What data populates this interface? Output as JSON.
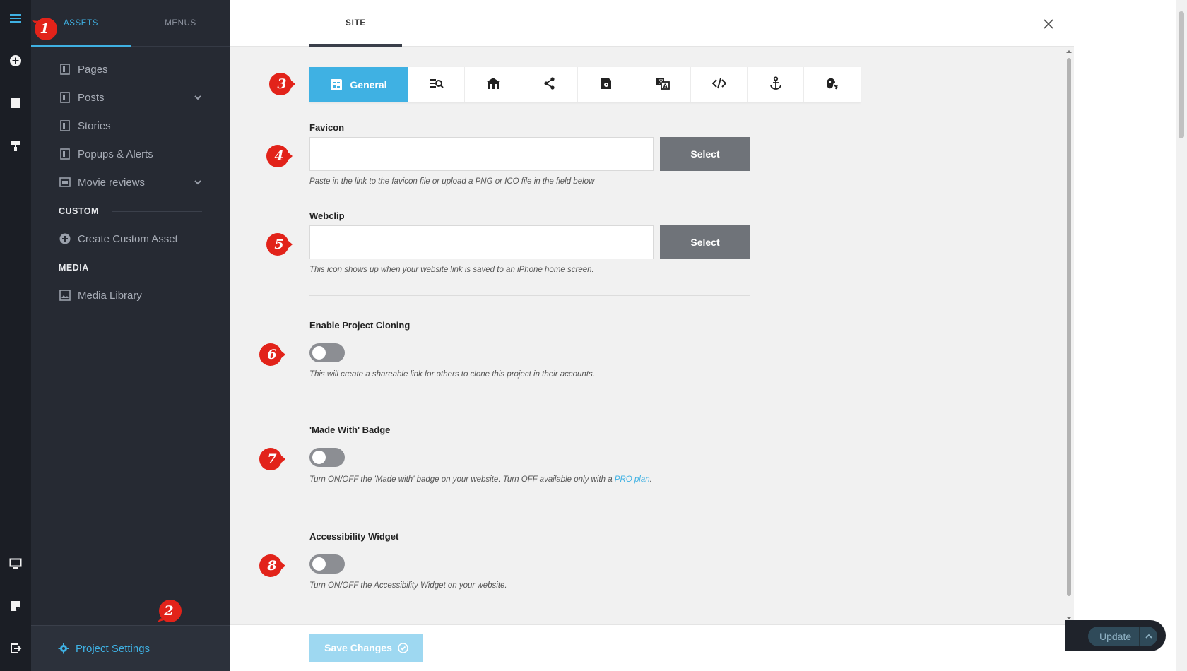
{
  "colors": {
    "accent": "#3fb1e3",
    "marker": "#e2231a",
    "rail_bg": "#1b1e25",
    "panel_bg": "#262a33"
  },
  "rail": {
    "icons": [
      "menu-icon",
      "add-icon",
      "layers-icon",
      "paint-roller-icon",
      "monitor-icon",
      "note-icon",
      "exit-icon"
    ]
  },
  "assets_panel": {
    "tabs": [
      {
        "label": "ASSETS",
        "active": true
      },
      {
        "label": "MENUS",
        "active": false
      }
    ],
    "items": [
      {
        "label": "Pages",
        "icon": "page-icon"
      },
      {
        "label": "Posts",
        "icon": "page-icon",
        "expandable": true
      },
      {
        "label": "Stories",
        "icon": "page-icon"
      },
      {
        "label": "Popups & Alerts",
        "icon": "page-icon"
      },
      {
        "label": "Movie reviews",
        "icon": "ticket-icon",
        "expandable": true
      }
    ],
    "custom_label": "CUSTOM",
    "create_custom": "Create Custom Asset",
    "media_label": "MEDIA",
    "media_library": "Media Library",
    "project_settings": "Project Settings"
  },
  "modal": {
    "tab": "SITE",
    "icon_tabs": [
      {
        "label": "General",
        "icon": "general-icon",
        "active": true
      },
      {
        "icon": "seo-search-icon"
      },
      {
        "icon": "store-icon"
      },
      {
        "icon": "share-icon"
      },
      {
        "icon": "file-settings-icon"
      },
      {
        "icon": "translate-icon"
      },
      {
        "icon": "code-icon"
      },
      {
        "icon": "anchor-icon"
      },
      {
        "icon": "cookie-icon"
      }
    ],
    "favicon": {
      "label": "Favicon",
      "value": "",
      "button": "Select",
      "help": "Paste in the link to the favicon file or upload a PNG or ICO file in the field below"
    },
    "webclip": {
      "label": "Webclip",
      "value": "",
      "button": "Select",
      "help": "This icon shows up when your website link is saved to an iPhone home screen."
    },
    "cloning": {
      "label": "Enable Project Cloning",
      "enabled": false,
      "help": "This will create a shareable link for others to clone this project in their accounts."
    },
    "badge": {
      "label": "'Made With' Badge",
      "enabled": false,
      "help_prefix": "Turn ON/OFF the 'Made with' badge on your website. Turn OFF available only with a ",
      "help_link": "PRO plan",
      "help_suffix": "."
    },
    "accessibility": {
      "label": "Accessibility Widget",
      "enabled": false,
      "help": "Turn ON/OFF the Accessibility Widget on your website."
    },
    "save_button": "Save Changes"
  },
  "page": {
    "update_button": "Update"
  },
  "markers": [
    "1",
    "2",
    "3",
    "4",
    "5",
    "6",
    "7",
    "8"
  ]
}
